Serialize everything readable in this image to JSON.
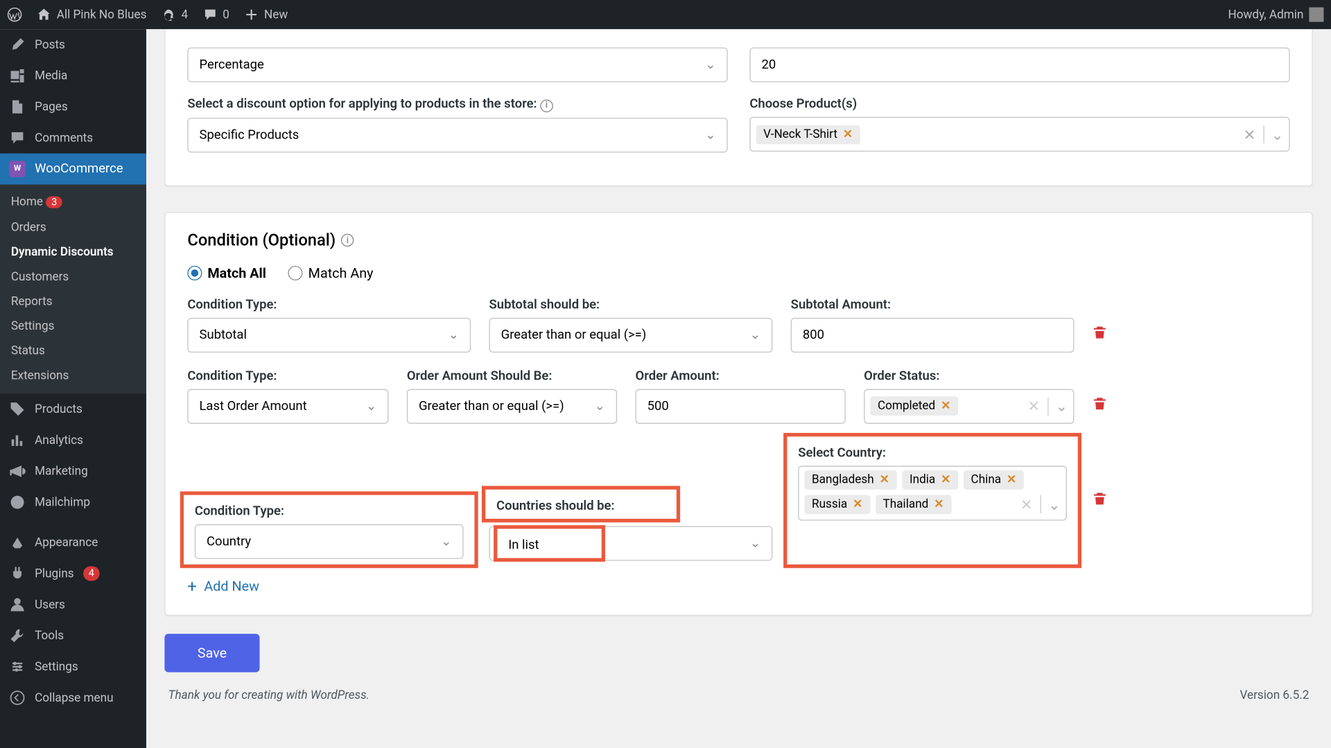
{
  "adminbar": {
    "site": "All Pink No Blues",
    "updates": "4",
    "comments": "0",
    "new": "New",
    "howdy": "Howdy, Admin"
  },
  "sidebar": {
    "posts": "Posts",
    "media": "Media",
    "pages": "Pages",
    "comments": "Comments",
    "woocommerce": "WooCommerce",
    "sub": {
      "home": "Home",
      "home_badge": "3",
      "orders": "Orders",
      "dynamic": "Dynamic Discounts",
      "customers": "Customers",
      "reports": "Reports",
      "settings": "Settings",
      "status": "Status",
      "extensions": "Extensions"
    },
    "products": "Products",
    "analytics": "Analytics",
    "marketing": "Marketing",
    "mailchimp": "Mailchimp",
    "appearance": "Appearance",
    "plugins": "Plugins",
    "plugins_badge": "4",
    "users": "Users",
    "tools": "Tools",
    "settings2": "Settings",
    "collapse": "Collapse menu"
  },
  "discount": {
    "type_label": "",
    "type_value": "Percentage",
    "amount_value": "20",
    "option_label": "Select a discount option for applying to products in the store:",
    "option_value": "Specific Products",
    "products_label": "Choose Product(s)",
    "product_tag": "V-Neck T-Shirt"
  },
  "cond": {
    "title": "Condition (Optional)",
    "match_all": "Match All",
    "match_any": "Match Any",
    "add_new": "Add New",
    "row1": {
      "type_label": "Condition Type:",
      "type_value": "Subtotal",
      "cmp_label": "Subtotal should be:",
      "cmp_value": "Greater than or equal (>=)",
      "amt_label": "Subtotal Amount:",
      "amt_value": "800"
    },
    "row2": {
      "type_label": "Condition Type:",
      "type_value": "Last Order Amount",
      "cmp_label": "Order Amount Should Be:",
      "cmp_value": "Greater than or equal (>=)",
      "amt_label": "Order Amount:",
      "amt_value": "500",
      "status_label": "Order Status:",
      "status_tag": "Completed"
    },
    "row3": {
      "type_label": "Condition Type:",
      "type_value": "Country",
      "cmp_label": "Countries should be:",
      "cmp_value": "In list",
      "sel_label": "Select Country:",
      "tags": {
        "0": "Bangladesh",
        "1": "India",
        "2": "China",
        "3": "Russia",
        "4": "Thailand"
      }
    }
  },
  "save": "Save",
  "footer": {
    "thanks": "Thank you for creating with WordPress.",
    "version": "Version 6.5.2"
  }
}
